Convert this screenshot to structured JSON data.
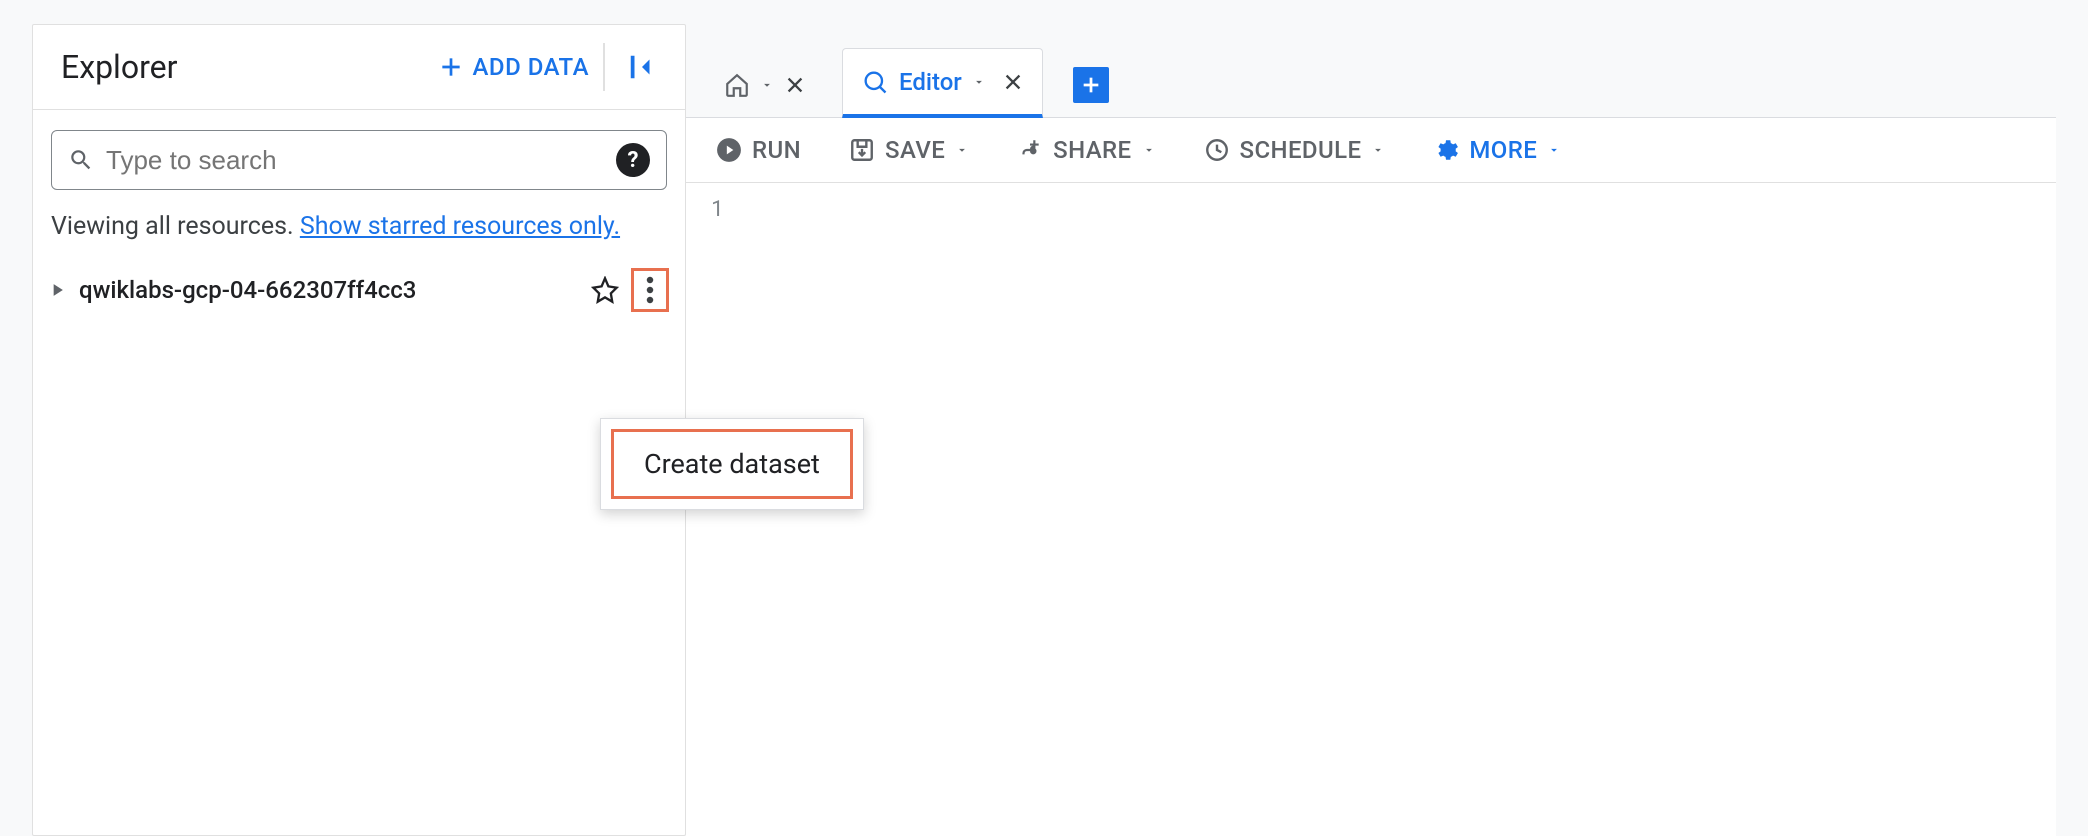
{
  "sidebar": {
    "title": "Explorer",
    "add_data_label": "ADD DATA",
    "search_placeholder": "Type to search",
    "viewing_prefix": "Viewing all resources. ",
    "viewing_link": "Show starred resources only.",
    "resource_name": "qwiklabs-gcp-04-662307ff4cc3"
  },
  "popup": {
    "create_dataset_label": "Create dataset"
  },
  "tabs": {
    "editor_label": "Editor"
  },
  "actions": {
    "run": "RUN",
    "save": "SAVE",
    "share": "SHARE",
    "schedule": "SCHEDULE",
    "more": "MORE"
  },
  "editor": {
    "line_number": "1"
  }
}
